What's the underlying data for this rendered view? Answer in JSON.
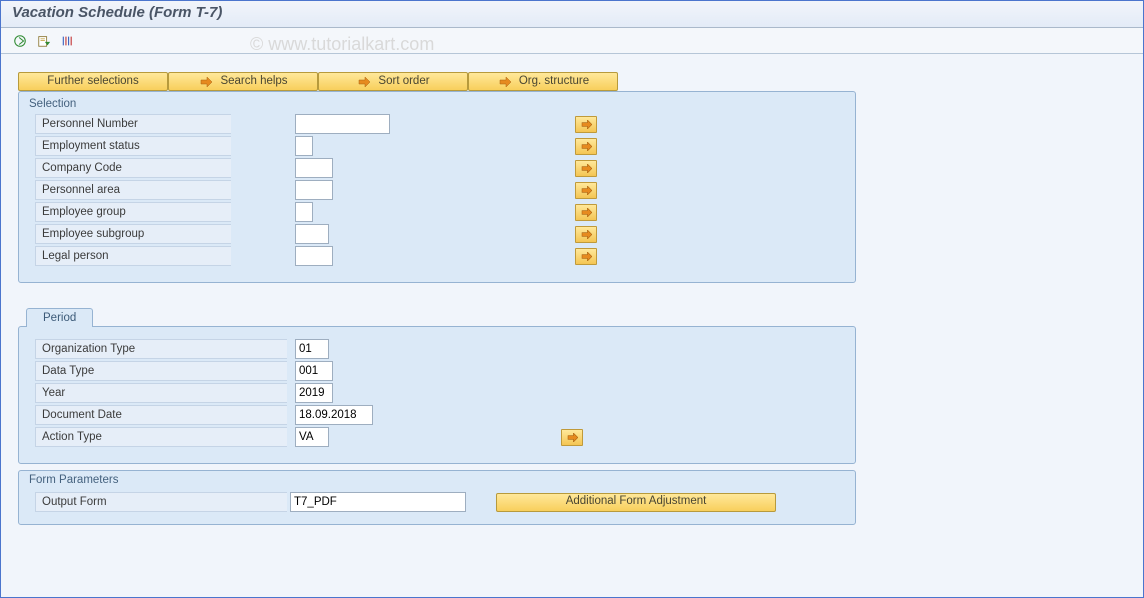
{
  "title": "Vacation Schedule (Form T-7)",
  "watermark": "© www.tutorialkart.com",
  "toolbar_icons": [
    "execute-icon",
    "get-variant-icon",
    "status-icon"
  ],
  "button_bar": {
    "further_selections": "Further selections",
    "search_helps": "Search helps",
    "sort_order": "Sort order",
    "org_structure": "Org. structure"
  },
  "selection": {
    "title": "Selection",
    "fields": {
      "personnel_number": {
        "label": "Personnel Number",
        "value": ""
      },
      "employment_status": {
        "label": "Employment status",
        "value": ""
      },
      "company_code": {
        "label": "Company Code",
        "value": ""
      },
      "personnel_area": {
        "label": "Personnel area",
        "value": ""
      },
      "employee_group": {
        "label": "Employee group",
        "value": ""
      },
      "employee_subgroup": {
        "label": "Employee subgroup",
        "value": ""
      },
      "legal_person": {
        "label": "Legal person",
        "value": ""
      }
    }
  },
  "period": {
    "tab_label": "Period",
    "fields": {
      "organization_type": {
        "label": "Organization Type",
        "value": "01"
      },
      "data_type": {
        "label": "Data Type",
        "value": "001"
      },
      "year": {
        "label": "Year",
        "value": "2019"
      },
      "document_date": {
        "label": "Document Date",
        "value": "18.09.2018"
      },
      "action_type": {
        "label": "Action Type",
        "value": "VA"
      }
    }
  },
  "form_parameters": {
    "title": "Form Parameters",
    "output_form": {
      "label": "Output Form",
      "value": "T7_PDF"
    },
    "additional_button": "Additional Form Adjustment"
  }
}
